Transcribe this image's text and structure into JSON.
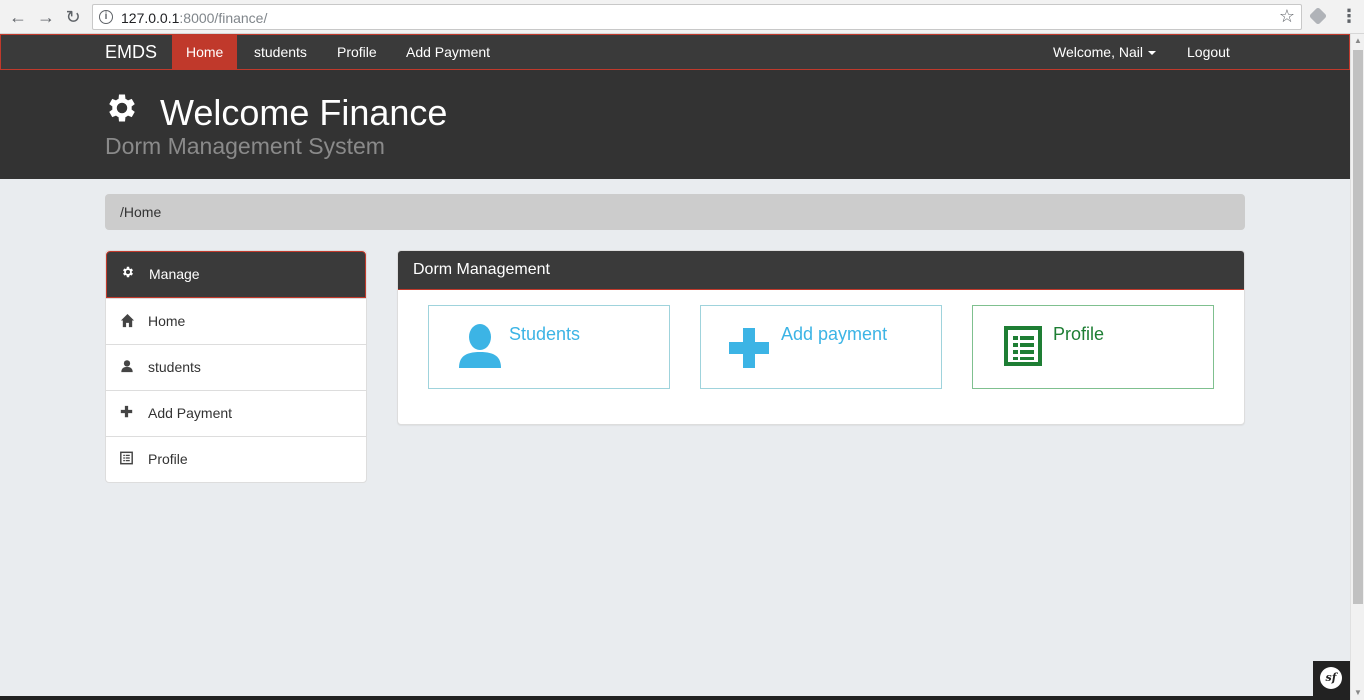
{
  "browser": {
    "url_host": "127.0.0.1",
    "url_rest": ":8000/finance/",
    "info_icon": "info-icon",
    "bookmark_icon": "star-icon"
  },
  "navbar": {
    "brand": "EMDS",
    "items": [
      "Home",
      "students",
      "Profile",
      "Add Payment"
    ],
    "active": "Home",
    "welcome": "Welcome, Nail",
    "logout": "Logout"
  },
  "header": {
    "title": "Welcome Finance",
    "subtitle": "Dorm Management System",
    "icon": "gear-icon"
  },
  "breadcrumb": "/Home",
  "sidebar": {
    "heading": "Manage",
    "items": [
      {
        "label": "Home",
        "icon": "home-icon"
      },
      {
        "label": "students",
        "icon": "user-icon"
      },
      {
        "label": "Add Payment",
        "icon": "plus-icon"
      },
      {
        "label": "Profile",
        "icon": "list-icon"
      }
    ]
  },
  "panel": {
    "heading": "Dorm Management",
    "tiles": [
      {
        "label": "Students",
        "icon": "user-icon",
        "color": "#3cb4e5"
      },
      {
        "label": "Add payment",
        "icon": "plus-icon",
        "color": "#3cb4e5"
      },
      {
        "label": "Profile",
        "icon": "list-icon",
        "color": "#1e7e34"
      }
    ]
  },
  "colors": {
    "accent": "#c0392b",
    "dark": "#333333",
    "blue": "#3cb4e5",
    "green": "#1e7e34"
  },
  "debug_badge": "sf"
}
